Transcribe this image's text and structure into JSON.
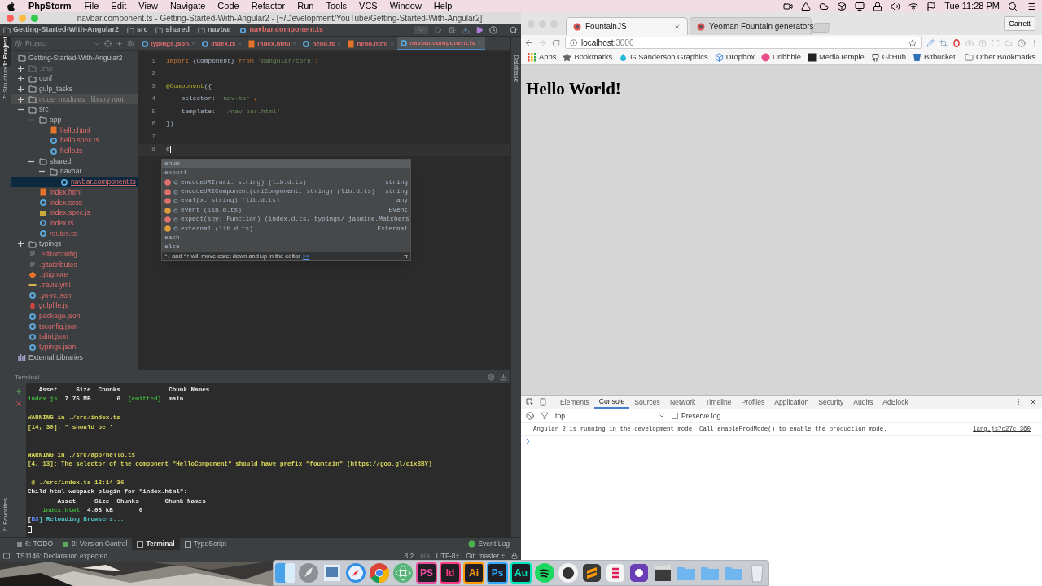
{
  "menubar": {
    "app": "PhpStorm",
    "menus": [
      "File",
      "Edit",
      "View",
      "Navigate",
      "Code",
      "Refactor",
      "Run",
      "Tools",
      "VCS",
      "Window",
      "Help"
    ],
    "clock": "Tue 11:28 PM"
  },
  "ide": {
    "title": "navbar.component.ts - Getting-Started-With-Angular2 - [~/Development/YouTube/Getting-Started-With-Angular2]",
    "breadcrumbs": [
      "Getting-Started-With-Angular2",
      "src",
      "shared",
      "navbar",
      "navbar.component.ts"
    ],
    "left_tool_windows": [
      {
        "label": "1: Project",
        "selected": true
      },
      {
        "label": "7: Structure",
        "selected": false
      }
    ],
    "favorites": "2: Favorites",
    "right_tool_windows": [
      "Database"
    ],
    "project": {
      "title": "Project",
      "tree": [
        {
          "name": "Getting-Started-With-Angular2",
          "kind": "folder",
          "selected": false,
          "children": [
            {
              "name": ".tmp",
              "kind": "excluded-folder",
              "expanded": false,
              "selected": false
            },
            {
              "name": "conf",
              "kind": "folder",
              "expanded": false,
              "selected": false
            },
            {
              "name": "gulp_tasks",
              "kind": "folder",
              "expanded": false,
              "selected": false
            },
            {
              "name": "node_modules",
              "note": "library root",
              "kind": "library-folder",
              "expanded": false,
              "selected": false
            },
            {
              "name": "src",
              "kind": "folder",
              "expanded": true,
              "selected": false,
              "children": [
                {
                  "name": "app",
                  "kind": "folder",
                  "expanded": true,
                  "selected": false,
                  "children": [
                    {
                      "name": "hello.html",
                      "kind": "html",
                      "selected": false
                    },
                    {
                      "name": "hello.spec.ts",
                      "kind": "ts",
                      "selected": false
                    },
                    {
                      "name": "hello.ts",
                      "kind": "ts",
                      "selected": false
                    }
                  ]
                },
                {
                  "name": "shared",
                  "kind": "folder",
                  "expanded": true,
                  "selected": false,
                  "children": [
                    {
                      "name": "navbar",
                      "kind": "folder",
                      "expanded": true,
                      "selected": false,
                      "children": [
                        {
                          "name": "navbar.component.ts",
                          "kind": "ts",
                          "selected": true
                        }
                      ]
                    }
                  ]
                },
                {
                  "name": "index.html",
                  "kind": "html",
                  "selected": false
                },
                {
                  "name": "index.scss",
                  "kind": "ts",
                  "selected": false
                },
                {
                  "name": "index.spec.js",
                  "kind": "js",
                  "selected": false
                },
                {
                  "name": "index.ts",
                  "kind": "ts",
                  "selected": false
                },
                {
                  "name": "routes.ts",
                  "kind": "ts",
                  "selected": false
                }
              ]
            },
            {
              "name": "typings",
              "kind": "folder",
              "expanded": false,
              "selected": false
            },
            {
              "name": ".editorconfig",
              "kind": "config",
              "selected": false
            },
            {
              "name": ".gitattributes",
              "kind": "config",
              "selected": false
            },
            {
              "name": ".gitignore",
              "kind": "git",
              "selected": false
            },
            {
              "name": ".travis.yml",
              "kind": "yaml",
              "selected": false
            },
            {
              "name": ".yo-rc.json",
              "kind": "ts",
              "selected": false
            },
            {
              "name": "gulpfile.js",
              "kind": "gulp",
              "selected": false
            },
            {
              "name": "package.json",
              "kind": "ts",
              "selected": false
            },
            {
              "name": "tsconfig.json",
              "kind": "ts",
              "selected": false
            },
            {
              "name": "tslint.json",
              "kind": "ts",
              "selected": false
            },
            {
              "name": "typings.json",
              "kind": "ts",
              "selected": false
            }
          ]
        },
        {
          "name": "External Libraries",
          "kind": "library",
          "selected": false
        }
      ]
    },
    "tabs": [
      {
        "label": "typings.json",
        "kind": "ts",
        "selected": false
      },
      {
        "label": "index.ts",
        "kind": "ts",
        "selected": false
      },
      {
        "label": "index.html",
        "kind": "html",
        "selected": false
      },
      {
        "label": "hello.ts",
        "kind": "ts",
        "selected": false
      },
      {
        "label": "hello.html",
        "kind": "html",
        "selected": false
      },
      {
        "label": "navbar.component.ts",
        "kind": "ts",
        "selected": true
      }
    ],
    "editor": {
      "lines": [
        {
          "no": "1",
          "segments": [
            {
              "text": "import ",
              "kind": "keyword"
            },
            {
              "text": "{Component} ",
              "kind": "plain"
            },
            {
              "text": "from ",
              "kind": "keyword"
            },
            {
              "text": "'@angular/core'",
              "kind": "string"
            },
            {
              "text": ";",
              "kind": "keyword"
            }
          ]
        },
        {
          "no": "2"
        },
        {
          "no": "3",
          "segments": [
            {
              "text": "@Component",
              "kind": "annotation"
            },
            {
              "text": "({",
              "kind": "plain"
            }
          ]
        },
        {
          "no": "4",
          "segments": [
            {
              "text": "    selector: ",
              "kind": "plain"
            },
            {
              "text": "'nav-bar'",
              "kind": "string"
            },
            {
              "text": ",",
              "kind": "keyword"
            }
          ]
        },
        {
          "no": "5",
          "segments": [
            {
              "text": "    template: ",
              "kind": "plain"
            },
            {
              "text": "'./nav-bar.html'",
              "kind": "string"
            }
          ]
        },
        {
          "no": "6",
          "segments": [
            {
              "text": "})",
              "kind": "plain"
            }
          ]
        },
        {
          "no": "7"
        },
        {
          "no": "8",
          "current": true,
          "segments": [
            {
              "text": "e",
              "kind": "plain"
            }
          ]
        }
      ],
      "completion": {
        "items": [
          {
            "kind": "keyword",
            "text": "enum",
            "selected": true
          },
          {
            "kind": "keyword",
            "text": "export",
            "selected": false
          },
          {
            "kind": "function",
            "text": "encodeURI(uri: string) (lib.d.ts)",
            "type": "string",
            "selected": false
          },
          {
            "kind": "function",
            "text": "encodeURIComponent(uriComponent: string) (lib.d.ts)",
            "type": "string",
            "selected": false
          },
          {
            "kind": "function",
            "text": "eval(x: string) (lib.d.ts)",
            "type": "any",
            "selected": false
          },
          {
            "kind": "variable",
            "text": "event (lib.d.ts)",
            "type": "Event",
            "selected": false
          },
          {
            "kind": "function",
            "text": "expect(spy: Function) (index.d.ts, typings/ jasmine.Matchers",
            "selected": false
          },
          {
            "kind": "variable",
            "text": "external (lib.d.ts)",
            "type": "External",
            "selected": false
          },
          {
            "kind": "keyword",
            "text": "each",
            "selected": false
          },
          {
            "kind": "keyword",
            "text": "else",
            "selected": false
          }
        ],
        "hint": "^↓ and ^↑ will move caret down and up in the editor",
        "hint_link": ">>",
        "pin": "π"
      }
    },
    "terminal": {
      "title": "Terminal",
      "lines": [
        {
          "segments": [
            {
              "text": "   Asset     Size  Chunks             Chunk Names",
              "kind": "plain"
            }
          ]
        },
        {
          "segments": [
            {
              "text": "index.js",
              "kind": "ok"
            },
            {
              "text": "  7.76 MB       0  ",
              "kind": "plain"
            },
            {
              "text": "[emitted]",
              "kind": "ok"
            },
            {
              "text": "  main",
              "kind": "plain"
            }
          ]
        },
        {
          "kind": "blank"
        },
        {
          "segments": [
            {
              "text": "WARNING in ./src/index.ts",
              "kind": "warning"
            }
          ]
        },
        {
          "segments": [
            {
              "text": "[14, 30]: \" should be '",
              "kind": "warning"
            }
          ]
        },
        {
          "kind": "blank"
        },
        {
          "kind": "blank"
        },
        {
          "segments": [
            {
              "text": "WARNING in ./src/app/hello.ts",
              "kind": "warning"
            }
          ]
        },
        {
          "segments": [
            {
              "text": "[4, 13]: The selector of the component \"HelloComponent\" should have prefix \"fountain\" (https://goo.gl/cix8BY)",
              "kind": "warning"
            }
          ]
        },
        {
          "kind": "blank"
        },
        {
          "segments": [
            {
              "text": " @ ./src/index.ts 12:14-36",
              "kind": "warning"
            }
          ]
        },
        {
          "segments": [
            {
              "text": "Child html-webpack-plugin for \"index.html\":",
              "kind": "plain"
            }
          ]
        },
        {
          "segments": [
            {
              "text": "        Asset     Size  Chunks       Chunk Names",
              "kind": "plain"
            }
          ]
        },
        {
          "segments": [
            {
              "text": "    index.html",
              "kind": "ok"
            },
            {
              "text": "  4.03 kB       0",
              "kind": "plain"
            }
          ]
        },
        {
          "segments": [
            {
              "text": "[",
              "kind": "plain"
            },
            {
              "text": "BS",
              "kind": "tag"
            },
            {
              "text": "] Reloading Browsers...",
              "kind": "info"
            }
          ]
        },
        {
          "kind": "cursor"
        }
      ]
    },
    "tool_tabs": [
      {
        "label": "6: TODO",
        "kind": "todo",
        "selected": false
      },
      {
        "label": "9: Version Control",
        "kind": "vcs",
        "selected": false
      },
      {
        "label": "Terminal",
        "kind": "terminal",
        "selected": true
      },
      {
        "label": "TypeScript",
        "kind": "typescript",
        "selected": false
      }
    ],
    "event_log": "Event Log",
    "status": {
      "message": "TS1146: Declaration expected.",
      "position": "8:2",
      "na": "n/a",
      "encoding": "UTF-8÷",
      "vcs": "Git: master ÷"
    }
  },
  "browser": {
    "tabs": [
      {
        "label": "FountainJS",
        "selected": true
      },
      {
        "label": "Yeoman Fountain generators",
        "selected": false
      }
    ],
    "profile": "Garrett",
    "url": {
      "host": "localhost",
      "port": ":3000"
    },
    "bookmarks": [
      {
        "label": "Apps",
        "kind": "apps"
      },
      {
        "label": "Bookmarks",
        "kind": "star"
      },
      {
        "label": "G Sanderson Graphics",
        "kind": "drop"
      },
      {
        "label": "Dropbox",
        "kind": "dropbox"
      },
      {
        "label": "Dribbble",
        "kind": "ball"
      },
      {
        "label": "MediaTemple",
        "kind": "square"
      },
      {
        "label": "GitHub",
        "kind": "github"
      },
      {
        "label": "Bitbucket",
        "kind": "bucket"
      }
    ],
    "other_bookmarks": "Other Bookmarks",
    "heading": "Hello World!",
    "devtools": {
      "tabs": [
        {
          "label": "Elements",
          "selected": false
        },
        {
          "label": "Console",
          "selected": true
        },
        {
          "label": "Sources",
          "selected": false
        },
        {
          "label": "Network",
          "selected": false
        },
        {
          "label": "Timeline",
          "selected": false
        },
        {
          "label": "Profiles",
          "selected": false
        },
        {
          "label": "Application",
          "selected": false
        },
        {
          "label": "Security",
          "selected": false
        },
        {
          "label": "Audits",
          "selected": false
        },
        {
          "label": "AdBlock",
          "selected": false
        }
      ],
      "context": "top",
      "preserve_log": {
        "label": "Preserve log",
        "checked": false
      },
      "message": "Angular 2 is running in the development mode. Call enableProdMode() to enable the production mode.",
      "source": "lang.js?c27c:360"
    }
  },
  "dock": [
    {
      "kind": "finder"
    },
    {
      "kind": "rocket"
    },
    {
      "kind": "preview"
    },
    {
      "kind": "compass"
    },
    {
      "kind": "chrome"
    },
    {
      "kind": "atom"
    },
    {
      "kind": "label",
      "label": "PS",
      "color": "#e84c9b"
    },
    {
      "kind": "label",
      "label": "Id",
      "color": "#ff3d7f"
    },
    {
      "kind": "label",
      "label": "Ai",
      "color": "#ff9a00"
    },
    {
      "kind": "label",
      "label": "Ps",
      "color": "#31a8ff"
    },
    {
      "kind": "label",
      "label": "Au",
      "color": "#00e4bb"
    },
    {
      "kind": "spotify"
    },
    {
      "kind": "octocat"
    },
    {
      "kind": "sublime"
    },
    {
      "kind": "slack"
    },
    {
      "kind": "purple"
    },
    {
      "kind": "clapper"
    },
    {
      "kind": "folder"
    },
    {
      "kind": "folder"
    },
    {
      "kind": "folder"
    },
    {
      "kind": "trash"
    }
  ]
}
